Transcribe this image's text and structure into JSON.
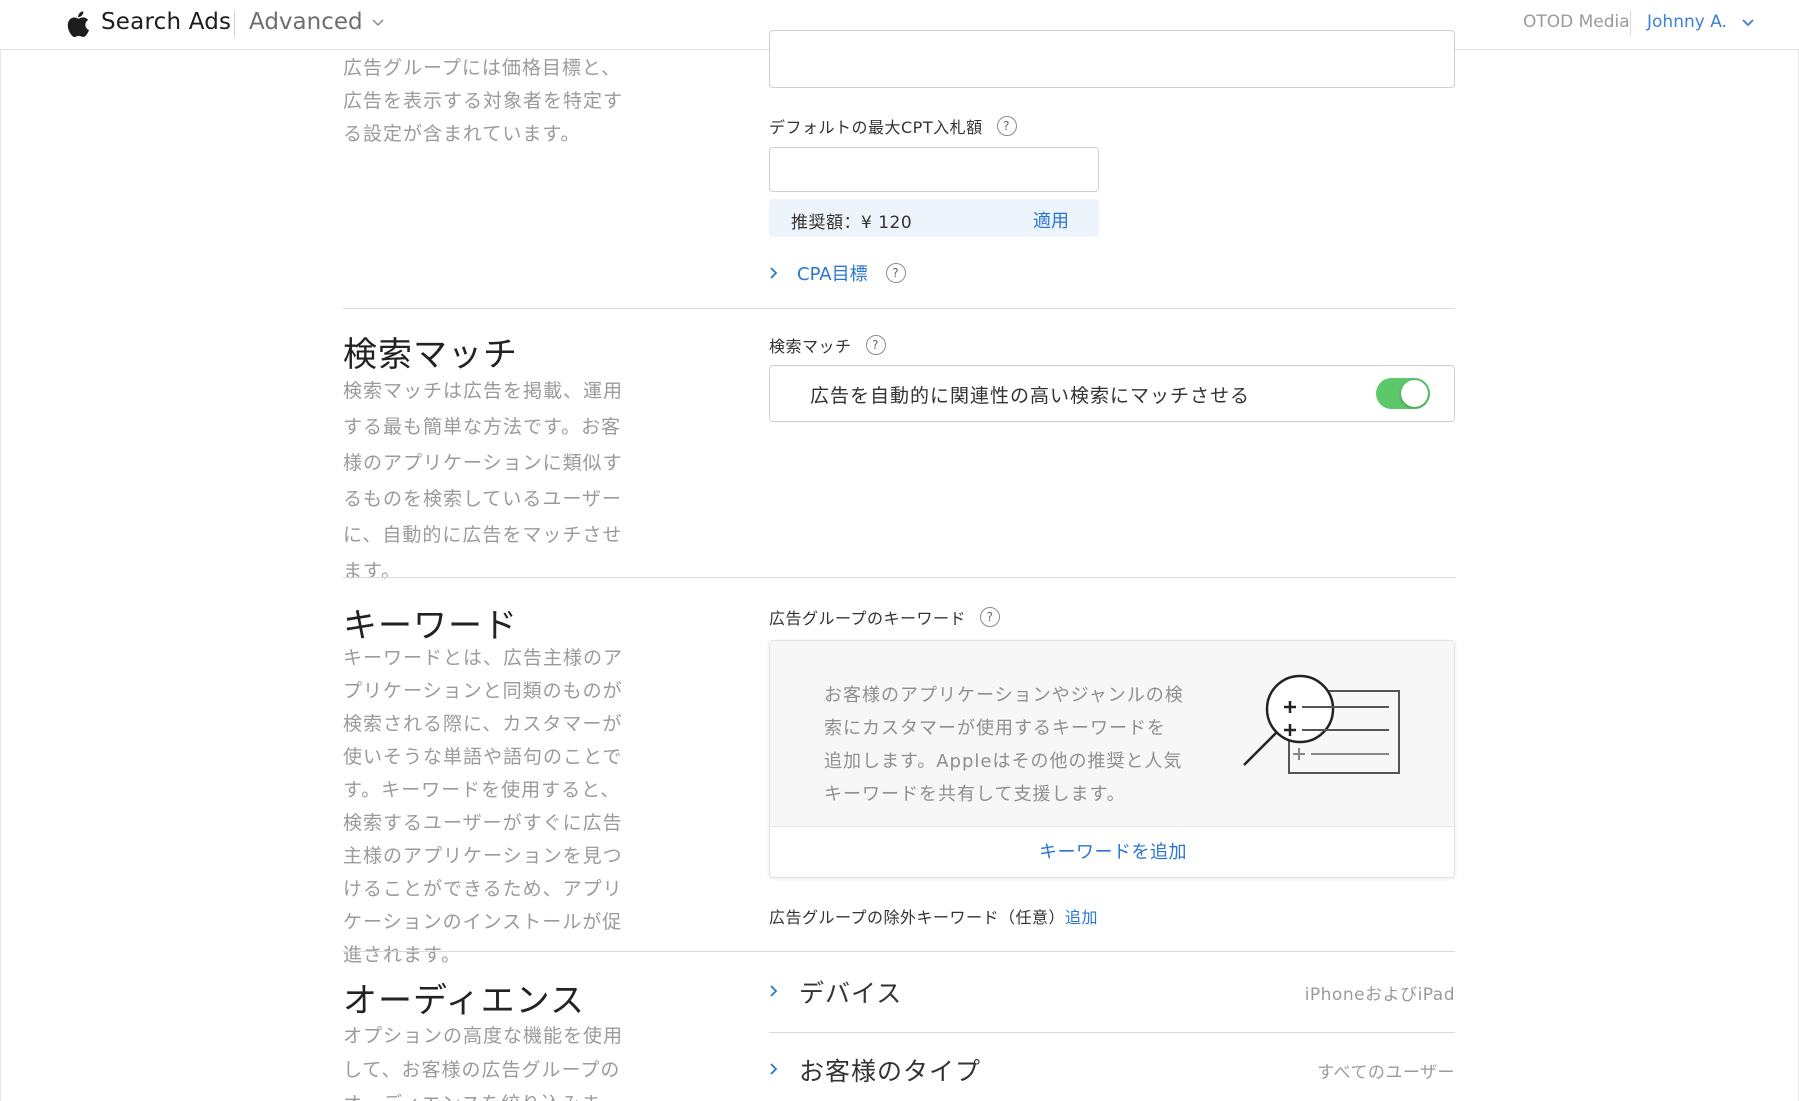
{
  "header": {
    "brand": "Search Ads",
    "product": "Advanced",
    "org": "OTOD Media",
    "user": "Johnny A.",
    "icons": [
      "apple-logo-icon",
      "chevron-down-icon"
    ]
  },
  "adgroup_intro": {
    "desc": "広告グループには価格目標と、広告を表示する対象者を特定する設定が含まれています。"
  },
  "bidding": {
    "max_cpt_label": "デフォルトの最大CPT入札額",
    "max_cpt_value": "",
    "suggested_text": "推奨額：¥ 120",
    "apply_label": "適用",
    "cpa_label": "CPA目標",
    "help_glyph": "?"
  },
  "search_match": {
    "title": "検索マッチ",
    "desc": "検索マッチは広告を掲載、運用する最も簡単な方法です。お客様のアプリケーションに類似するものを検索しているユーザーに、自動的に広告をマッチさせます。",
    "field_label": "検索マッチ",
    "toggle_text": "広告を自動的に関連性の高い検索にマッチさせる",
    "toggle_on": true,
    "toggle_color": "#5cc86b"
  },
  "keywords": {
    "title": "キーワード",
    "desc": "キーワードとは、広告主様のアプリケーションと同類のものが検索される際に、カスタマーが使いそうな単語や語句のことです。キーワードを使用すると、検索するユーザーがすぐに広告主様のアプリケーションを見つけることができるため、アプリケーションのインストールが促進されます。",
    "field_label": "広告グループのキーワード",
    "card_text": "お客様のアプリケーションやジャンルの検索にカスタマーが使用するキーワードを追加します。Appleはその他の推奨と人気キーワードを共有して支援します。",
    "add_label": "キーワードを追加",
    "negative_label": "広告グループの除外キーワード（任意）",
    "negative_add": "追加"
  },
  "audience": {
    "title": "オーディエンス",
    "desc": "オプションの高度な機能を使用して、お客様の広告グループのオーディエンスを絞り込みます。",
    "rows": [
      {
        "label": "デバイス",
        "value": "iPhoneおよびiPad"
      },
      {
        "label": "お客様のタイプ",
        "value": "すべてのユーザー"
      }
    ]
  },
  "colors": {
    "link": "#2a76d2",
    "user": "#3b7fd8"
  }
}
